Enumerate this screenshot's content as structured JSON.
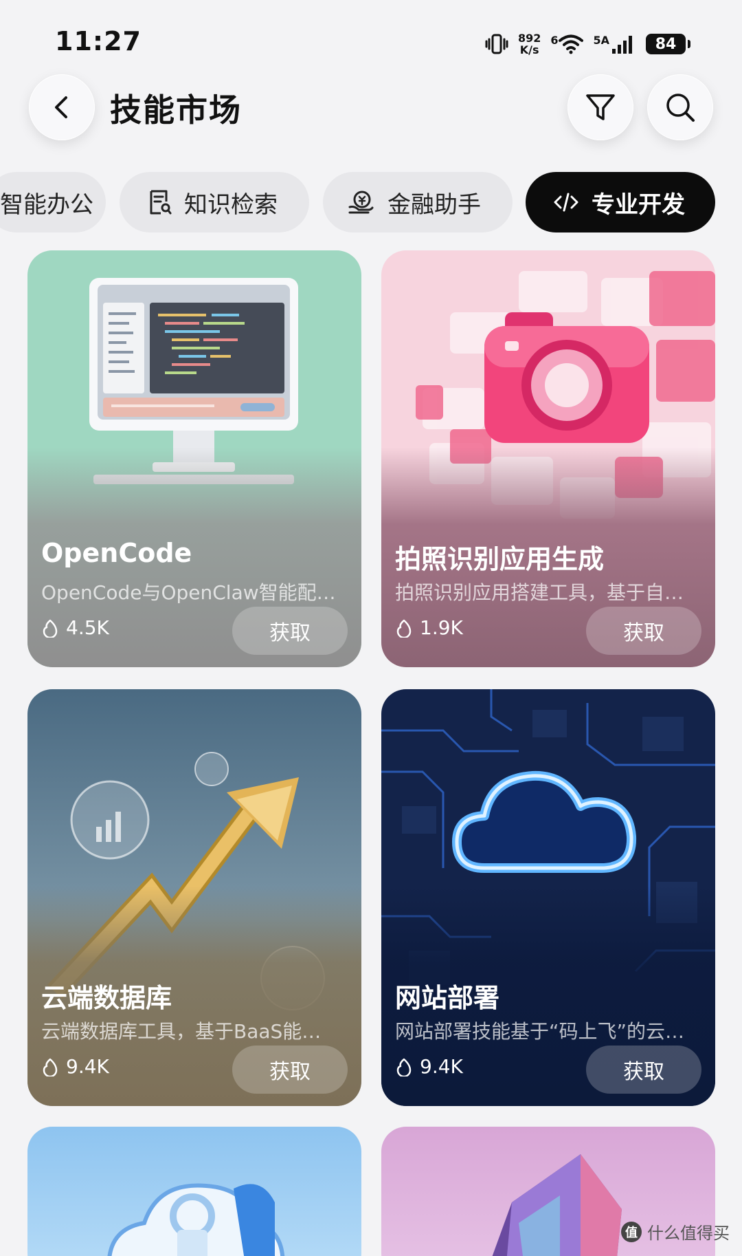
{
  "status_bar": {
    "time": "11:27",
    "net_speed_value": "892",
    "net_speed_unit": "K/s",
    "wifi_label": "6",
    "cell_label": "5A",
    "battery": "84"
  },
  "header": {
    "title": "技能市场"
  },
  "tabs": [
    {
      "label": "智能办公",
      "icon": "briefcase-icon",
      "active": false
    },
    {
      "label": "知识检索",
      "icon": "document-search-icon",
      "active": false
    },
    {
      "label": "金融助手",
      "icon": "money-hand-icon",
      "active": false
    },
    {
      "label": "专业开发",
      "icon": "code-icon",
      "active": true
    }
  ],
  "cards": [
    {
      "title": "OpenCode",
      "desc": "OpenCode与OpenClaw智能配…",
      "count": "4.5K",
      "button": "获取",
      "art": "computer-monitor"
    },
    {
      "title": "拍照识别应用生成",
      "desc": "拍照识别应用搭建工具，基于自…",
      "count": "1.9K",
      "button": "获取",
      "art": "pink-camera"
    },
    {
      "title": "云端数据库",
      "desc": "云端数据库工具，基于BaaS能…",
      "count": "9.4K",
      "button": "获取",
      "art": "gold-arrow-chart"
    },
    {
      "title": "网站部署",
      "desc": "网站部署技能基于“码上飞”的云…",
      "count": "9.4K",
      "button": "获取",
      "art": "neon-cloud"
    }
  ],
  "watermark": {
    "text": "什么值得买",
    "icon_text": "值"
  },
  "colors": {
    "active_tab_bg": "#0c0c0c",
    "tab_bg": "#e7e7ea",
    "page_bg": "#f3f3f5"
  }
}
